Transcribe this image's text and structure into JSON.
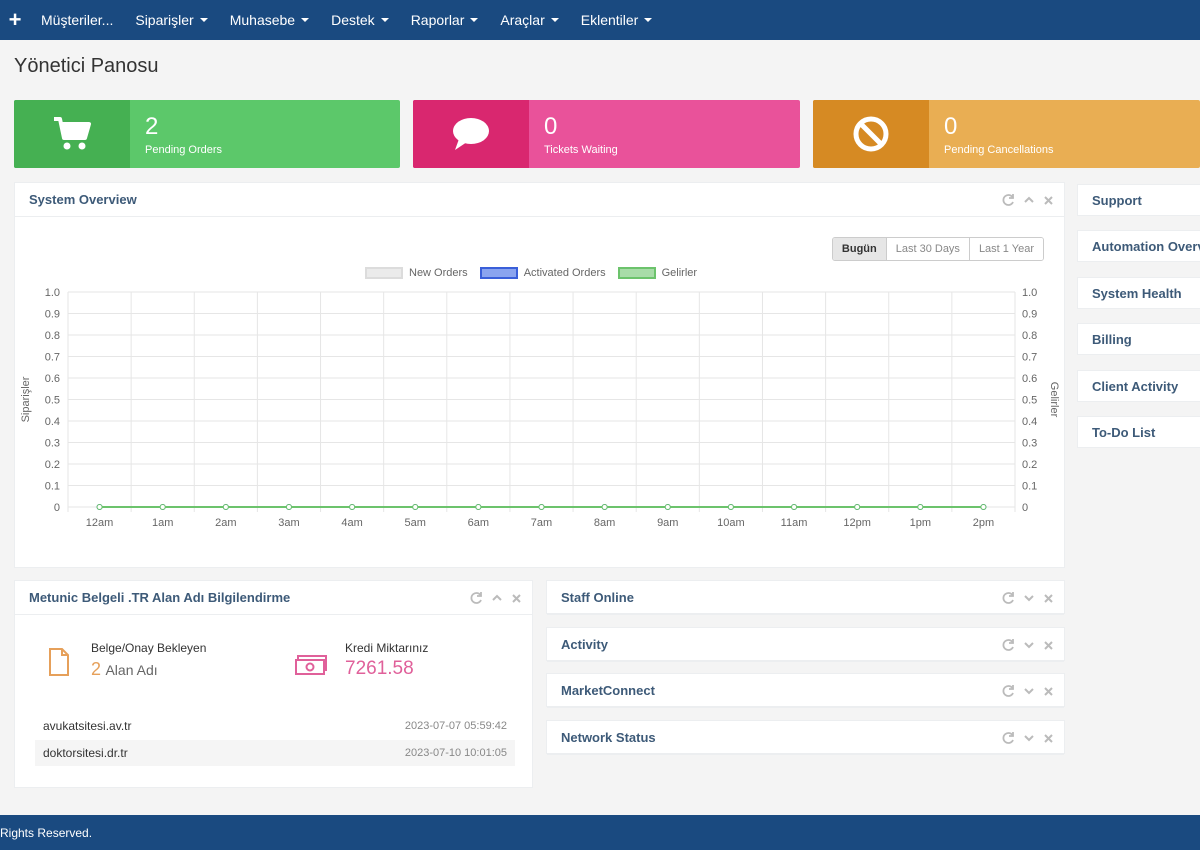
{
  "nav": {
    "items": [
      "Müşteriler...",
      "Siparişler",
      "Muhasebe",
      "Destek",
      "Raporlar",
      "Araçlar",
      "Eklentiler"
    ]
  },
  "page": {
    "title": "Yönetici Panosu"
  },
  "tiles": [
    {
      "value": "2",
      "label": "Pending Orders",
      "icon": "shopping-cart-icon",
      "color": "#5cc86a"
    },
    {
      "value": "0",
      "label": "Tickets Waiting",
      "icon": "speech-bubble-icon",
      "color": "#e9529a"
    },
    {
      "value": "0",
      "label": "Pending Cancellations",
      "icon": "ban-icon",
      "color": "#e9ae53"
    }
  ],
  "system_overview": {
    "title": "System Overview",
    "ranges": [
      "Bugün",
      "Last 30 Days",
      "Last 1 Year"
    ],
    "active_range": "Bugün"
  },
  "chart_data": {
    "type": "line",
    "x": [
      "12am",
      "1am",
      "2am",
      "3am",
      "4am",
      "5am",
      "6am",
      "7am",
      "8am",
      "9am",
      "10am",
      "11am",
      "12pm",
      "1pm",
      "2pm"
    ],
    "series": [
      {
        "name": "New Orders",
        "values": [
          0,
          0,
          0,
          0,
          0,
          0,
          0,
          0,
          0,
          0,
          0,
          0,
          0,
          0,
          0
        ],
        "color": "#dcdcdc"
      },
      {
        "name": "Activated Orders",
        "values": [
          0,
          0,
          0,
          0,
          0,
          0,
          0,
          0,
          0,
          0,
          0,
          0,
          0,
          0,
          0
        ],
        "color": "#3a5fd9"
      },
      {
        "name": "Gelirler",
        "values": [
          0,
          0,
          0,
          0,
          0,
          0,
          0,
          0,
          0,
          0,
          0,
          0,
          0,
          0,
          0
        ],
        "color": "#6cc36c"
      }
    ],
    "y_ticks": [
      "1.0",
      "0.9",
      "0.8",
      "0.7",
      "0.6",
      "0.5",
      "0.4",
      "0.3",
      "0.2",
      "0.1",
      "0"
    ],
    "ylabel_left": "Siparişler",
    "ylabel_right": "Gelirler",
    "ylim": [
      0,
      1
    ],
    "grid": true,
    "legend": "top-center"
  },
  "sidebar": {
    "items": [
      "Support",
      "Automation Overview",
      "System Health",
      "Billing",
      "Client Activity",
      "To-Do List"
    ]
  },
  "metunic": {
    "title": "Metunic Belgeli .TR Alan Adı Bilgilendirme",
    "pending_label": "Belge/Onay Bekleyen",
    "pending_count": "2",
    "pending_unit": "Alan Adı",
    "credit_label": "Kredi Miktarınız",
    "credit_value": "7261.58",
    "domains": [
      {
        "name": "avukatsitesi.av.tr",
        "date": "2023-07-07 05:59:42"
      },
      {
        "name": "doktorsitesi.dr.tr",
        "date": "2023-07-10 10:01:05"
      }
    ]
  },
  "mini_panels": [
    "Staff Online",
    "Activity",
    "MarketConnect",
    "Network Status"
  ],
  "footer": {
    "text": "Rights Reserved."
  }
}
